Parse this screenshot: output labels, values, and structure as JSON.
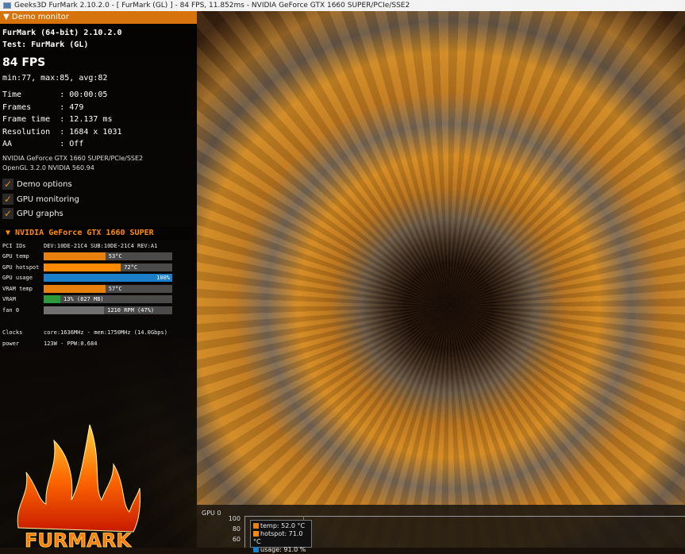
{
  "window": {
    "title": "Geeks3D FurMark 2.10.2.0 - [ FurMark (GL) ] - 84 FPS, 11.852ms - NVIDIA GeForce GTX 1660 SUPER/PCIe/SSE2"
  },
  "monitor": {
    "header": "Demo monitor",
    "app": "FurMark (64-bit) 2.10.2.0",
    "test": "Test: FurMark (GL)",
    "fps": "84 FPS",
    "fps_stats": "min:77, max:85, avg:82",
    "stats": [
      "Time        : 00:00:05",
      "Frames      : 479",
      "Frame time  : 12.137 ms",
      "Resolution  : 1684 x 1031",
      "AA          : Off"
    ],
    "renderer": "NVIDIA GeForce GTX 1660 SUPER/PCIe/SSE2",
    "opengl": "OpenGL 3.2.0 NVIDIA 560.94",
    "checkboxes": [
      {
        "label": "Demo options",
        "checked": true
      },
      {
        "label": "GPU monitoring",
        "checked": true
      },
      {
        "label": "GPU graphs",
        "checked": true
      }
    ]
  },
  "gpu": {
    "header": "NVIDIA GeForce GTX 1660 SUPER",
    "pci_label": "PCI IDs",
    "pci": "DEV:10DE-21C4 SUB:10DE-21C4 REV:A1",
    "bars": [
      {
        "label": "GPU temp",
        "value": "53°C",
        "fraction": 0.48,
        "color": "#e8800e"
      },
      {
        "label": "GPU hotspot",
        "value": "72°C",
        "fraction": 0.6,
        "color": "#ff8a00"
      },
      {
        "label": "GPU usage",
        "value": "100%",
        "fraction": 1.0,
        "color": "#1a7fc8"
      },
      {
        "label": "VRAM temp",
        "value": "57°C",
        "fraction": 0.48,
        "color": "#e8800e"
      },
      {
        "label": "VRAM",
        "value": "13% (827 MB)",
        "fraction": 0.13,
        "color": "#2a9a3a"
      },
      {
        "label": "fan 0",
        "value": "1210 RPM (47%)",
        "fraction": 0.47,
        "color": "#707070"
      }
    ],
    "clocks_label": "Clocks",
    "clocks": "core:1636MHz - mem:1750MHz (14.0Gbps)",
    "power_label": "power",
    "power": "123W - PPW:0.684"
  },
  "graph": {
    "title": "GPU 0",
    "yticks": [
      "100",
      "80",
      "60"
    ],
    "legend": [
      {
        "text": "temp: 52.0 °C",
        "color": "#e8800e"
      },
      {
        "text": "hotspot: 71.0 °C",
        "color": "#ff8a00"
      },
      {
        "text": "usage: 91.0 %",
        "color": "#1a7fc8"
      }
    ]
  },
  "logo": {
    "text": "FURMARK"
  }
}
